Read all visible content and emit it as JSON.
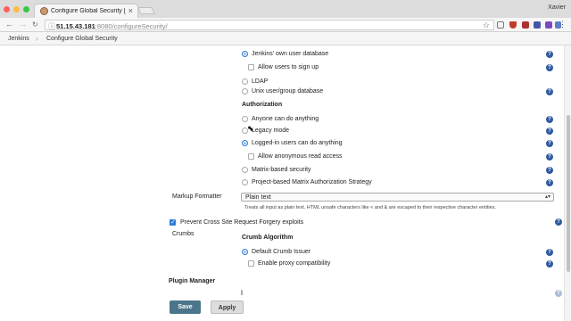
{
  "browser": {
    "tab_title": "Configure Global Security [Je",
    "tab_close": "×",
    "profile_name": "Xavier",
    "url_host": "51.15.43.181",
    "url_path": ":8080/configureSecurity/",
    "back_icon": "←",
    "forward_icon": "→",
    "reload_icon": "C",
    "star_icon": "☆",
    "menu_icon": "⋮",
    "extension_colors": [
      "#3f6fb5",
      "#c23b2a",
      "#b03030",
      "#4455aa",
      "#7a4bbf",
      "#5a7ec9",
      "#8a8a8a"
    ]
  },
  "breadcrumbs": {
    "root": "Jenkins",
    "separator": "›",
    "current": "Configure Global Security"
  },
  "security_realm": {
    "jenkins_db_label": "Jenkins' own user database",
    "jenkins_db_selected": true,
    "allow_signup_label": "Allow users to sign up",
    "allow_signup_checked": false,
    "ldap_label": "LDAP",
    "unix_label": "Unix user/group database"
  },
  "authorization": {
    "title": "Authorization",
    "options": [
      {
        "label": "Anyone can do anything",
        "selected": false
      },
      {
        "label": "Legacy mode",
        "selected": false
      },
      {
        "label": "Logged-in users can do anything",
        "selected": true
      },
      {
        "label": "Matrix-based security",
        "selected": false
      },
      {
        "label": "Project-based Matrix Authorization Strategy",
        "selected": false
      }
    ],
    "allow_anonymous_label": "Allow anonymous read access",
    "allow_anonymous_checked": false
  },
  "markup_formatter": {
    "label": "Markup Formatter",
    "value": "Plain text",
    "description": "Treats all input as plain text. HTML unsafe characters like < and & are escaped to their respective character entities."
  },
  "csrf": {
    "label": "Prevent Cross Site Request Forgery exploits",
    "checked": true,
    "crumbs_label": "Crumbs",
    "crumb_algorithm_title": "Crumb Algorithm",
    "default_issuer_label": "Default Crumb Issuer",
    "default_issuer_selected": true,
    "proxy_compat_label": "Enable proxy compatibility",
    "proxy_compat_checked": false
  },
  "plugin_manager": {
    "title": "Plugin Manager"
  },
  "buttons": {
    "save": "Save",
    "apply": "Apply"
  },
  "help_icon_glyph": "?"
}
